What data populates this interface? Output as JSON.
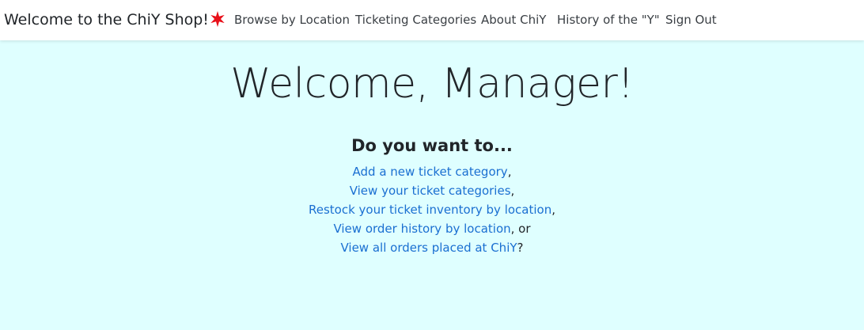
{
  "navbar": {
    "brand": "Welcome to the ChiY Shop!",
    "star_icon": "chicago-star-icon",
    "star_color": "#e8101a",
    "links": [
      "Browse by Location",
      "Ticketing Categories",
      "About ChiY",
      "History of the \"Y\"",
      "Sign Out"
    ]
  },
  "main": {
    "heading": "Welcome, Manager!",
    "question": "Do you want to...",
    "options": [
      {
        "link": "Add a new ticket category",
        "suffix": ","
      },
      {
        "link": "View your ticket categories",
        "suffix": ","
      },
      {
        "link": "Restock your ticket inventory by location",
        "suffix": ","
      },
      {
        "link": "View order history by location",
        "suffix": ", or"
      },
      {
        "link": "View all orders placed at ChiY",
        "suffix": "?"
      }
    ]
  },
  "colors": {
    "background": "#dfffff",
    "link": "#1a6fd1",
    "navbar": "#ffffff"
  }
}
